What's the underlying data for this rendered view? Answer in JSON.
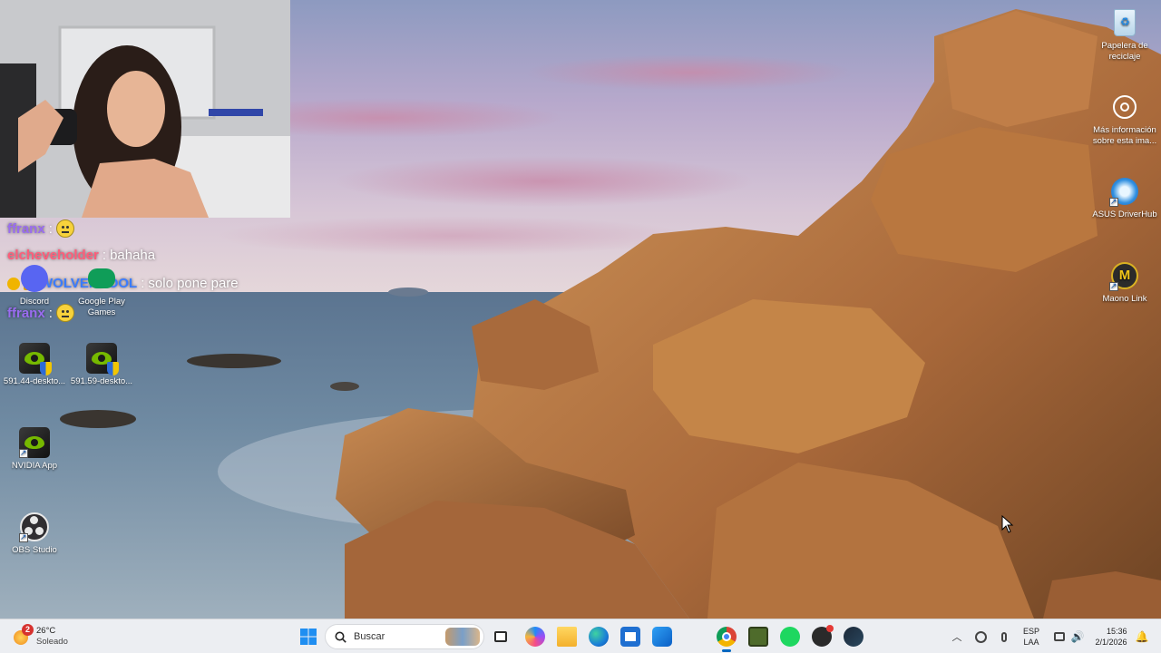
{
  "chat": {
    "lines": [
      {
        "user": "ffranx",
        "separator": ":",
        "message": "",
        "emoji": "neutral-face-emoji",
        "color": "#9a6cf0"
      },
      {
        "user": "elcheveholder",
        "separator": ":",
        "message": "bahaha",
        "color": "#ff5d7a"
      },
      {
        "user": "WOLVERPOOL",
        "separator": ":",
        "message": "solo pone pare",
        "color": "#3a7bff"
      },
      {
        "user": "ffranx",
        "separator": ":",
        "message": "",
        "emoji": "neutral-face-emoji",
        "color": "#9a6cf0"
      }
    ]
  },
  "desktop_icons": {
    "discord": "Discord",
    "google_play": "Google Play Games",
    "nvidia_591_44": "591.44-deskto...",
    "nvidia_591_59": "591.59-deskto...",
    "nvidia_app": "NVIDIA App",
    "obs": "OBS Studio",
    "recycle_bin": "Papelera de reciclaje",
    "more_info": "Más información sobre esta ima...",
    "asus": "ASUS DriverHub",
    "maono": "Maono Link"
  },
  "taskbar": {
    "weather_temp": "26°C",
    "weather_desc": "Soleado",
    "weather_badge": "2",
    "search_placeholder": "Buscar",
    "language_top": "ESP",
    "language_bottom": "LAA",
    "time": "15:36",
    "date": "2/1/2026",
    "colors": {
      "accent": "#0067c0",
      "background": "#eceef2"
    }
  }
}
